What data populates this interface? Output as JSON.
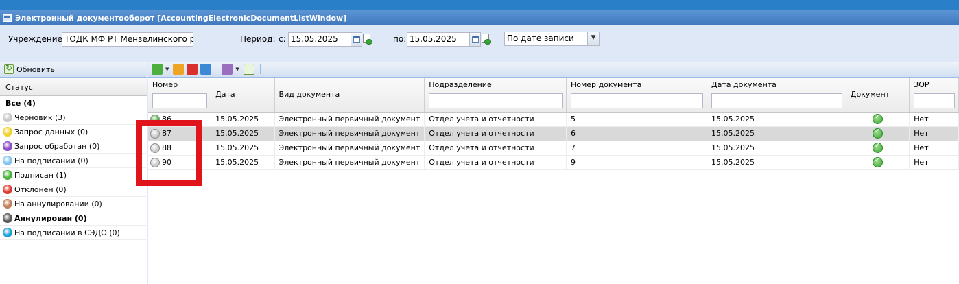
{
  "window": {
    "title": "Электронный документооборот [AccountingElectronicDocumentListWindow]"
  },
  "filters": {
    "institution_label": "Учреждение:",
    "institution_value": "ТОДК МФ РТ Мензелинского район",
    "period_label": "Период:",
    "from_label": "с:",
    "from_value": "15.05.2025",
    "to_label": "по:",
    "to_value": "15.05.2025",
    "sort_value": "По дате записи"
  },
  "left_panel": {
    "refresh_label": "Обновить",
    "header": "Статус",
    "all_label": "Все (4)",
    "statuses": [
      {
        "label": "Черновик (3)",
        "color": "#c8c8c8",
        "icon": "clock-gray-icon"
      },
      {
        "label": "Запрос данных (0)",
        "color": "#f2d12b",
        "icon": "request-yellow-icon"
      },
      {
        "label": "Запрос обработан (0)",
        "color": "#8a4fc4",
        "icon": "processed-purple-icon"
      },
      {
        "label": "На подписании (0)",
        "color": "#7fc4ef",
        "icon": "signing-lightblue-icon"
      },
      {
        "label": "Подписан (1)",
        "color": "#49b23d",
        "icon": "signed-green-icon"
      },
      {
        "label": "Отклонен (0)",
        "color": "#dc3b2f",
        "icon": "rejected-red-icon"
      },
      {
        "label": "На аннулировании (0)",
        "color": "#c0805a",
        "icon": "annulling-brown-icon"
      },
      {
        "label": "Аннулирован (0)",
        "color": "#5a5a5a",
        "icon": "annulled-darkgray-icon"
      },
      {
        "label": "На подписании в СЭДО (0)",
        "color": "#1f9fd6",
        "icon": "sedo-blue-icon"
      }
    ]
  },
  "toolbar": {
    "icons": [
      "add-icon",
      "edit-icon",
      "delete-icon",
      "copy-icon",
      "settings-icon",
      "refresh-icon"
    ]
  },
  "grid": {
    "columns": [
      "Номер",
      "Дата",
      "Вид документа",
      "Подразделение",
      "Номер документа",
      "Дата документа",
      "Документ",
      "ЗОР"
    ],
    "rows": [
      {
        "number": "86",
        "date": "15.05.2025",
        "doc_type": "Электронный первичный документ",
        "department": "Отдел учета и отчетности",
        "doc_number": "5",
        "doc_date": "15.05.2025",
        "zor": "Нет",
        "status_color": "#49b23d"
      },
      {
        "number": "87",
        "date": "15.05.2025",
        "doc_type": "Электронный первичный документ",
        "department": "Отдел учета и отчетности",
        "doc_number": "6",
        "doc_date": "15.05.2025",
        "zor": "Нет",
        "status_color": "#c8c8c8"
      },
      {
        "number": "88",
        "date": "15.05.2025",
        "doc_type": "Электронный первичный документ",
        "department": "Отдел учета и отчетности",
        "doc_number": "7",
        "doc_date": "15.05.2025",
        "zor": "Нет",
        "status_color": "#c8c8c8"
      },
      {
        "number": "90",
        "date": "15.05.2025",
        "doc_type": "Электронный первичный документ",
        "department": "Отдел учета и отчетности",
        "doc_number": "9",
        "doc_date": "15.05.2025",
        "zor": "Нет",
        "status_color": "#c8c8c8"
      }
    ]
  },
  "colors": {
    "highlight": "#e0151b",
    "selected_row": "#d9d9d9",
    "titlebar": "#4a86c8"
  }
}
